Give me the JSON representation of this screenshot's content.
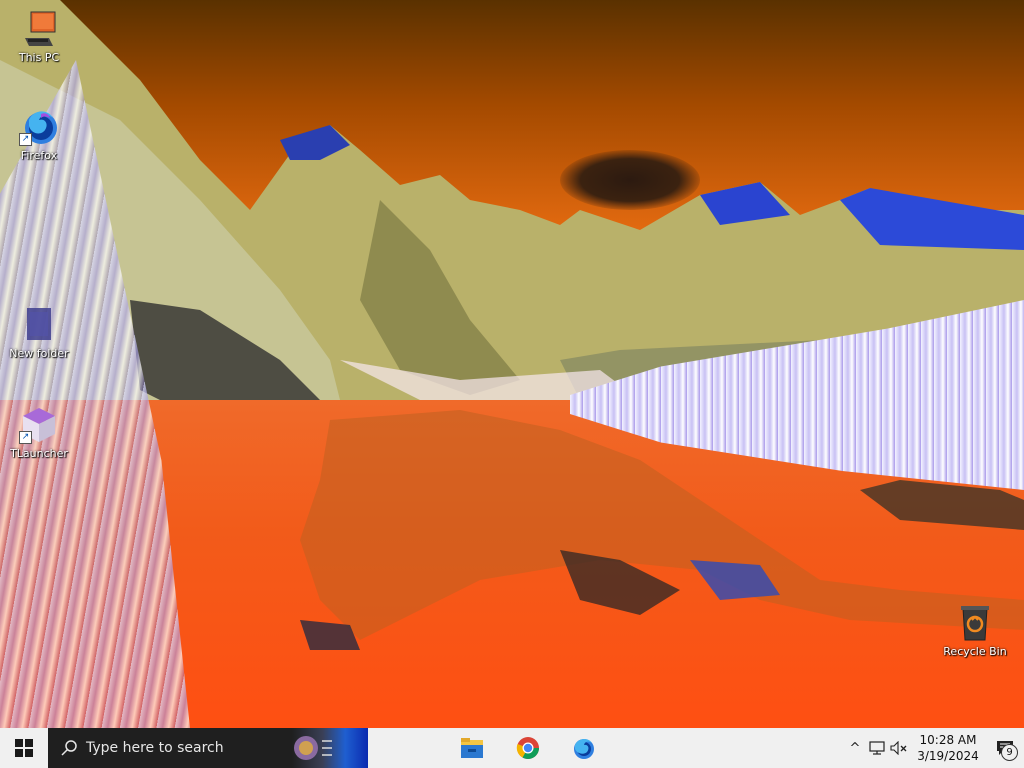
{
  "desktop": {
    "icons": [
      {
        "label": "This PC",
        "icon": "computer-icon",
        "shortcut": false
      },
      {
        "label": "Firefox",
        "icon": "firefox-icon",
        "shortcut": true
      },
      {
        "label": "New folder",
        "icon": "folder-icon",
        "shortcut": false
      },
      {
        "label": "TLauncher",
        "icon": "tlauncher-icon",
        "shortcut": true
      },
      {
        "label": "Recycle Bin",
        "icon": "recycle-bin-icon",
        "shortcut": false
      }
    ]
  },
  "taskbar": {
    "start_icon": "windows-logo-icon",
    "search_placeholder": "Type here to search",
    "pinned": [
      {
        "name": "File Explorer",
        "icon": "file-explorer-icon"
      },
      {
        "name": "Chrome",
        "icon": "chrome-icon"
      },
      {
        "name": "Firefox",
        "icon": "firefox-icon"
      }
    ],
    "tray": {
      "chevron": "^",
      "time": "10:28 AM",
      "date": "3/19/2024",
      "notification_count": "9"
    }
  },
  "colors": {
    "taskbar_bg": "#f0f0f0",
    "search_bg": "#1f1f1f",
    "windows_blue": "#0078d7"
  }
}
